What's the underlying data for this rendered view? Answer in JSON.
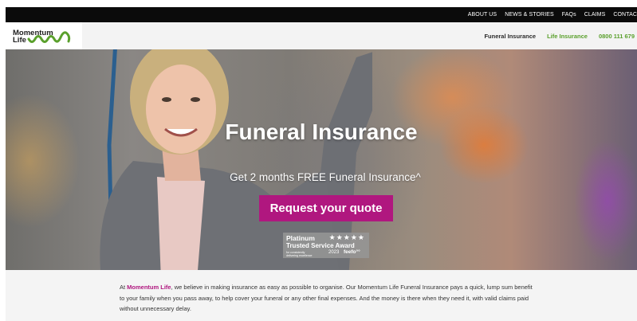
{
  "topnav": {
    "links": [
      "ABOUT US",
      "NEWS & STORIES",
      "FAQs",
      "CLAIMS",
      "CONTAC"
    ]
  },
  "header": {
    "logo_line1": "Momentum",
    "logo_line2": "Life",
    "nav": {
      "funeral": "Funeral Insurance",
      "life": "Life Insurance",
      "phone": "0800 111 679"
    }
  },
  "hero": {
    "title": "Funeral Insurance",
    "subtitle": "Get 2 months FREE Funeral Insurance^",
    "cta_label": "Request your quote",
    "award": {
      "platinum": "Platinum",
      "stars": "★★★★★",
      "title": "Trusted Service Award",
      "tagline": "for consistently delivering excellence",
      "year": "2023",
      "brand": "feefo°°"
    }
  },
  "intro": {
    "prefix": "At ",
    "brand": "Momentum Life",
    "text": ", we believe in making insurance as easy as possible to organise. Our Momentum Life Funeral Insurance pays a quick, lump sum benefit to your family when you pass away, to help cover your funeral or any other final expenses. And the money is there when they need it, with valid claims paid without unnecessary delay."
  },
  "colors": {
    "brand_magenta": "#b0177f",
    "brand_green": "#5aa02c",
    "topbar": "#0b0b0b"
  }
}
